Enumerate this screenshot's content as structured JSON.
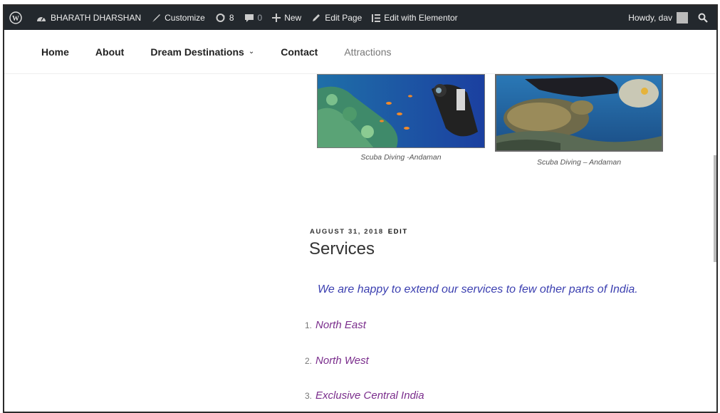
{
  "adminbar": {
    "site_name": "BHARATH DHARSHAN",
    "customize": "Customize",
    "updates_count": "8",
    "comments_count": "0",
    "new_label": "New",
    "edit_page": "Edit Page",
    "elementor": "Edit with Elementor",
    "howdy": "Howdy, dav"
  },
  "nav": {
    "items": [
      {
        "label": "Home"
      },
      {
        "label": "About"
      },
      {
        "label": "Dream Destinations"
      },
      {
        "label": "Contact"
      },
      {
        "label": "Attractions"
      }
    ]
  },
  "gallery": {
    "captions": [
      "Scuba Diving -Andaman",
      "Scuba Diving – Andaman"
    ]
  },
  "post": {
    "date": "AUGUST 31, 2018",
    "edit": "EDIT",
    "title": "Services",
    "lead": "We are happy to extend our services to few other parts of India.",
    "list": [
      {
        "num": "1.",
        "text": "North East"
      },
      {
        "num": "2.",
        "text": "North West"
      },
      {
        "num": "3.",
        "text": "Exclusive Central India"
      }
    ]
  }
}
